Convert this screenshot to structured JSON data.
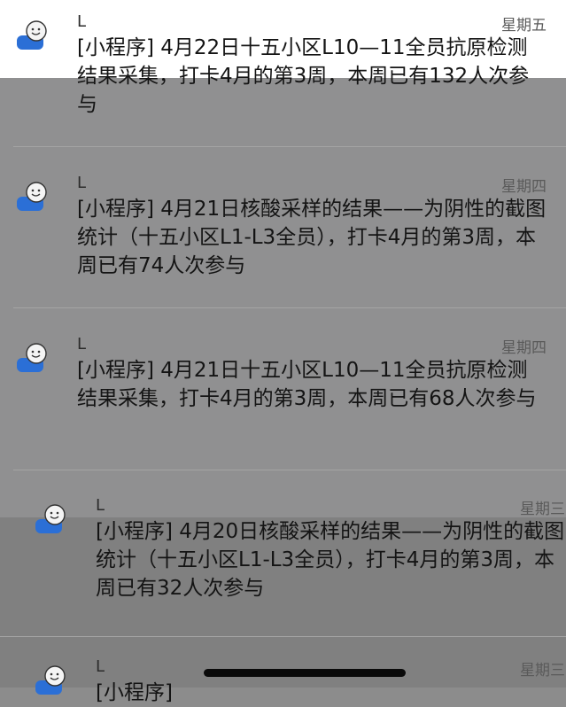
{
  "messages": [
    {
      "sender": "L",
      "day": "星期五",
      "text": "[小程序] 4月22日十五小区L10—11全员抗原检测结果采集，打卡4月的第3周，本周已有132人次参与"
    },
    {
      "sender": "L",
      "day": "星期四",
      "text": "[小程序] 4月21日核酸采样的结果——为阴性的截图统计（十五小区L1-L3全员），打卡4月的第3周，本周已有74人次参与"
    },
    {
      "sender": "L",
      "day": "星期四",
      "text": "[小程序] 4月21日十五小区L10—11全员抗原检测结果采集，打卡4月的第3周，本周已有68人次参与"
    },
    {
      "sender": "L",
      "day": "星期三",
      "text": "[小程序] 4月20日核酸采样的结果——为阴性的截图统计（十五小区L1-L3全员），打卡4月的第3周，本周已有32人次参与"
    },
    {
      "sender": "L",
      "day": "星期三",
      "text": "[小程序]"
    }
  ],
  "colors": {
    "avatar_face": "#f4f4f4",
    "avatar_body": "#2b6fd6",
    "text": "#141414"
  }
}
